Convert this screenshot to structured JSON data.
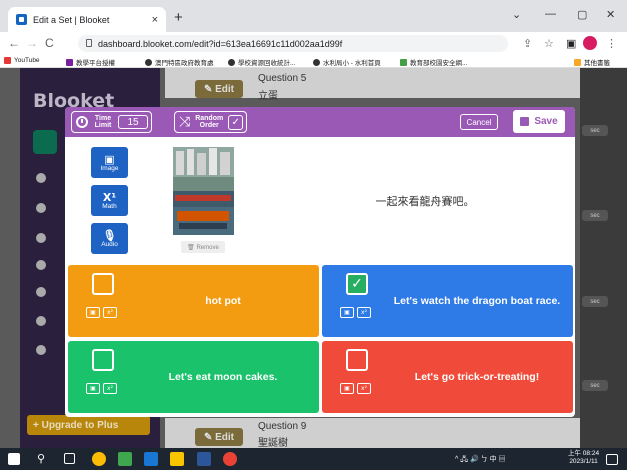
{
  "browser": {
    "tab_title": "Edit a Set | Blooket",
    "tab_close": "×",
    "new_tab": "+",
    "url": "dashboard.blooket.com/edit?id=613ea16691c11d002aa1d99f",
    "win_min": "—",
    "win_max": "▢",
    "win_close": "✕",
    "avatar_text": "🤖",
    "bookmarks": [
      "YouTube",
      "教學平台授權",
      "澳門特區政府教育處",
      "學校資源回收統計...",
      "水利局小 - 水利首頁",
      "教育部校園安全網..."
    ],
    "other_bookmarks": "其他書籤"
  },
  "background": {
    "logo": "Blooket",
    "upgrade": "+ Upgrade to Plus",
    "question_top": {
      "label": "Question 5",
      "answer": "立蛋",
      "edit": "✎ Edit"
    },
    "question_bottom": {
      "label": "Question 9",
      "answer": "聖誕樹",
      "edit": "✎ Edit"
    },
    "sec_label": "sec"
  },
  "modal": {
    "time_limit_label": "Time Limit",
    "time_limit_value": "15",
    "random_order_label": "Random Order",
    "random_order_checked": "✓",
    "cancel": "Cancel",
    "save": "Save",
    "media": {
      "image": "Image",
      "math": "Math",
      "audio": "Audio"
    },
    "remove": "🗑 Remove",
    "question_text": "一起來看龍舟賽吧。",
    "answers": [
      {
        "text": "hot pot",
        "correct": false,
        "color": "#f39c12"
      },
      {
        "text": "Let's watch the dragon boat race.",
        "correct": true,
        "color": "#2e7ae6"
      },
      {
        "text": "Let's eat moon cakes.",
        "correct": false,
        "color": "#19c26b"
      },
      {
        "text": "Let's go trick-or-treating!",
        "correct": false,
        "color": "#f04b3a"
      }
    ]
  },
  "taskbar": {
    "tray": "^ 🖧 🔊 ㄅ 中 ▤",
    "time": "上午 08:24",
    "date": "2023/1/11"
  }
}
